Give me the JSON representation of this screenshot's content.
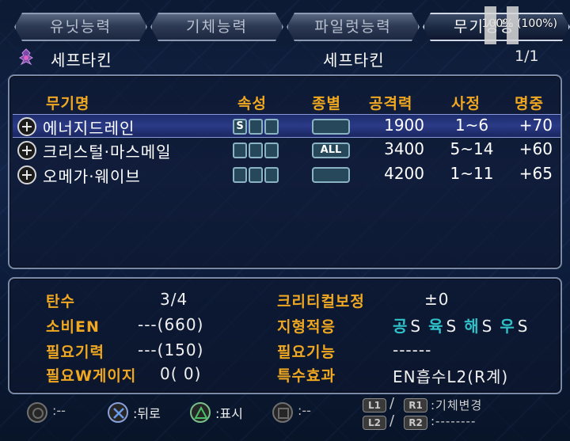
{
  "tabs": [
    {
      "label": "유닛능력",
      "active": false
    },
    {
      "label": "기체능력",
      "active": false
    },
    {
      "label": "파일럿능력",
      "active": false
    },
    {
      "label": "무기성능",
      "active": true
    }
  ],
  "zoom": "100% (100%)",
  "header": {
    "unit_name": "세프타킨",
    "pilot_name": "세프타킨",
    "page": "1/1"
  },
  "weapon_table": {
    "columns": {
      "name": "무기명",
      "attribute": "속성",
      "kind": "종별",
      "power": "공격력",
      "range": "사정",
      "accuracy": "명중"
    },
    "rows": [
      {
        "name": "에너지드레인",
        "attr": [
          "S",
          "",
          ""
        ],
        "kind": "",
        "power": "1900",
        "range": "1~6",
        "accuracy": "+70",
        "selected": true
      },
      {
        "name": "크리스털·마스메일",
        "attr": [
          "",
          "",
          ""
        ],
        "kind": "ALL",
        "power": "3400",
        "range": "5~14",
        "accuracy": "+60",
        "selected": false
      },
      {
        "name": "오메가·웨이브",
        "attr": [
          "",
          "",
          ""
        ],
        "kind": "",
        "power": "4200",
        "range": "1~11",
        "accuracy": "+65",
        "selected": false
      }
    ]
  },
  "stats": {
    "ammo_label": "탄수",
    "ammo_value": "3/4",
    "en_label": "소비EN",
    "en_value": "---(660)",
    "will_label": "필요기력",
    "will_value": "---(150)",
    "wgauge_label": "필요W게이지",
    "wgauge_value": "0(  0)",
    "crit_label": "크리티컬보정",
    "crit_value": "±0",
    "terrain_label": "지형적응",
    "terrain": [
      {
        "name": "공",
        "grade": "S"
      },
      {
        "name": "육",
        "grade": "S"
      },
      {
        "name": "해",
        "grade": "S"
      },
      {
        "name": "우",
        "grade": "S"
      }
    ],
    "skill_label": "필요기능",
    "skill_value": "------",
    "effect_label": "특수효과",
    "effect_value": "EN흡수L2(R계)"
  },
  "footer": {
    "circle_label": ":--",
    "cross_label": ":뒤로",
    "triangle_label": ":표시",
    "square_label": ":--",
    "l1": "L1",
    "r1": "R1",
    "l2": "L2",
    "r2": "R2",
    "lr1_label": ":기체변경",
    "lr2_label": ":--------"
  },
  "colors": {
    "label_orange": "#f0a820",
    "terrain_cyan": "#30c0c8",
    "selected_row": "#2a3a86"
  }
}
